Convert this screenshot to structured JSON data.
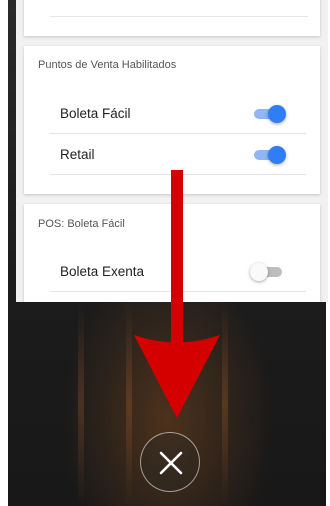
{
  "sections": {
    "puntos_de_venta": {
      "title": "Puntos de Venta Habilitados",
      "items": [
        {
          "label": "Boleta Fácil",
          "enabled": true
        },
        {
          "label": "Retail",
          "enabled": true
        }
      ]
    },
    "pos": {
      "title": "POS: Boleta Fácil",
      "items": [
        {
          "label": "Boleta Exenta",
          "enabled": false
        }
      ]
    }
  },
  "colors": {
    "toggle_on": "#2f7ef5",
    "arrow": "#d40000",
    "backdrop": "#1c1c1c"
  },
  "icons": {
    "overlay_arrow": "arrow-down-icon",
    "close": "close-icon"
  }
}
